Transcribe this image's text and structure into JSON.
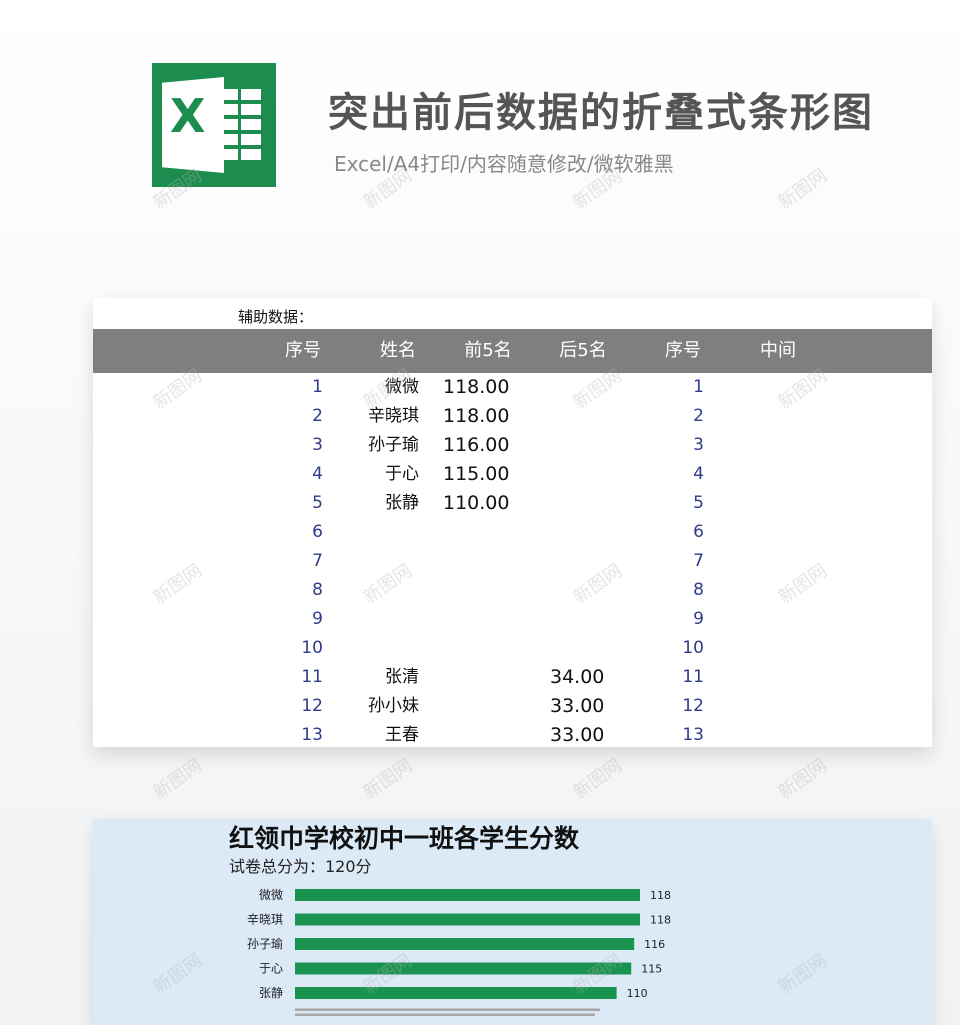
{
  "header": {
    "title": "突出前后数据的折叠式条形图",
    "subtitle": "Excel/A4打印/内容随意修改/微软雅黑"
  },
  "table": {
    "aux_label": "辅助数据：",
    "columns": [
      "序号",
      "姓名",
      "前5名",
      "后5名",
      "序号",
      "中间"
    ],
    "rows": [
      {
        "seq": "1",
        "name": "微微",
        "top5": "118.00",
        "bottom5": "",
        "seq2": "1",
        "middle": ""
      },
      {
        "seq": "2",
        "name": "辛晓琪",
        "top5": "118.00",
        "bottom5": "",
        "seq2": "2",
        "middle": ""
      },
      {
        "seq": "3",
        "name": "孙子瑜",
        "top5": "116.00",
        "bottom5": "",
        "seq2": "3",
        "middle": ""
      },
      {
        "seq": "4",
        "name": "于心",
        "top5": "115.00",
        "bottom5": "",
        "seq2": "4",
        "middle": ""
      },
      {
        "seq": "5",
        "name": "张静",
        "top5": "110.00",
        "bottom5": "",
        "seq2": "5",
        "middle": ""
      },
      {
        "seq": "6",
        "name": "",
        "top5": "",
        "bottom5": "",
        "seq2": "6",
        "middle": ""
      },
      {
        "seq": "7",
        "name": "",
        "top5": "",
        "bottom5": "",
        "seq2": "7",
        "middle": ""
      },
      {
        "seq": "8",
        "name": "",
        "top5": "",
        "bottom5": "",
        "seq2": "8",
        "middle": ""
      },
      {
        "seq": "9",
        "name": "",
        "top5": "",
        "bottom5": "",
        "seq2": "9",
        "middle": ""
      },
      {
        "seq": "10",
        "name": "",
        "top5": "",
        "bottom5": "",
        "seq2": "10",
        "middle": ""
      },
      {
        "seq": "11",
        "name": "张清",
        "top5": "",
        "bottom5": "34.00",
        "seq2": "11",
        "middle": ""
      },
      {
        "seq": "12",
        "name": "孙小妹",
        "top5": "",
        "bottom5": "33.00",
        "seq2": "12",
        "middle": ""
      },
      {
        "seq": "13",
        "name": "王春",
        "top5": "",
        "bottom5": "33.00",
        "seq2": "13",
        "middle": ""
      }
    ]
  },
  "chart": {
    "title": "红领巾学校初中一班各学生分数",
    "subtitle": "试卷总分为：120分"
  },
  "chart_data": {
    "type": "bar",
    "orientation": "horizontal",
    "title": "红领巾学校初中一班各学生分数",
    "categories": [
      "微微",
      "辛晓琪",
      "孙子瑜",
      "于心",
      "张静"
    ],
    "values": [
      118,
      118,
      116,
      115,
      110
    ],
    "xlim": [
      0,
      120
    ],
    "bar_color": "#1a9350",
    "data_labels": true,
    "grid": false
  },
  "watermark": "新图网",
  "colors": {
    "logo": "#1d8d4f",
    "table_header": "#7f7f7f",
    "seq_text": "#2e3a8c",
    "chart_bg": "#dce9f7"
  }
}
